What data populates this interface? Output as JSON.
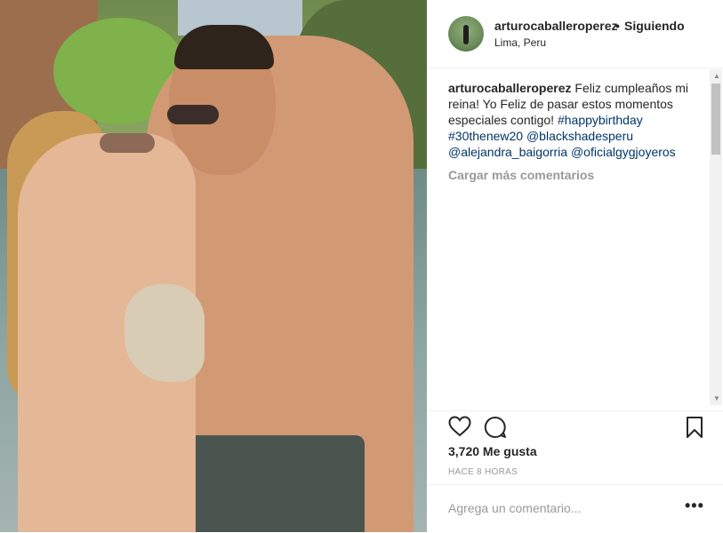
{
  "post": {
    "username": "arturocaballeroperez",
    "separator": "•",
    "follow_status": "Siguiendo",
    "location": "Lima, Peru"
  },
  "caption": {
    "username": "arturocaballeroperez",
    "text": "Feliz cumpleaños mi reina! Yo Feliz de pasar estos momentos especiales contigo! ",
    "tags": [
      "#happybirthday",
      "#30thenew20",
      "@blackshadesperu",
      "@alejandra_baigorria",
      "@oficialgygjoyeros"
    ]
  },
  "load_more": "Cargar más comentarios",
  "likes": "3,720 Me gusta",
  "timestamp": "HACE 8 HORAS",
  "add_comment": {
    "placeholder": "Agrega un comentario..."
  },
  "more_options": "•••",
  "icons": {
    "like": "heart-icon",
    "comment": "comment-icon",
    "save": "bookmark-icon",
    "scroll_up": "▲",
    "scroll_down": "▼"
  }
}
